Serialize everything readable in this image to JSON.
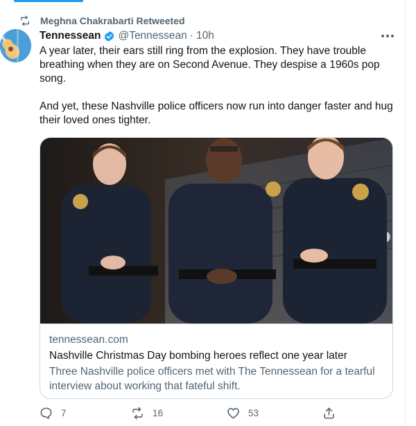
{
  "retweet": {
    "label": "Meghna Chakrabarti Retweeted"
  },
  "tweet": {
    "author_name": "Tennessean",
    "handle": "@Tennessean",
    "separator": "·",
    "time": "10h",
    "paragraphs": [
      "A year later, their ears still ring from the explosion. They have trouble breathing when they are on Second Avenue. They despise a 1960s pop song.",
      "And yet, these Nashville police officers now run into danger faster and hug their loved ones tighter."
    ]
  },
  "card": {
    "domain": "tennessean.com",
    "title": "Nashville Christmas Day bombing heroes reflect one year later",
    "description": "Three Nashville police officers met with The Tennessean for a tearful interview about working that fateful shift."
  },
  "actions": {
    "reply_count": "7",
    "retweet_count": "16",
    "like_count": "53"
  },
  "icons": {
    "retweet": "retweet-icon",
    "verified": "verified-badge-icon",
    "more": "more-options-icon",
    "reply": "reply-icon",
    "like": "heart-icon",
    "share": "share-icon"
  },
  "colors": {
    "accent": "#1d9bf0",
    "text": "#0f1419",
    "muted": "#536471",
    "border": "#cfd9de"
  }
}
